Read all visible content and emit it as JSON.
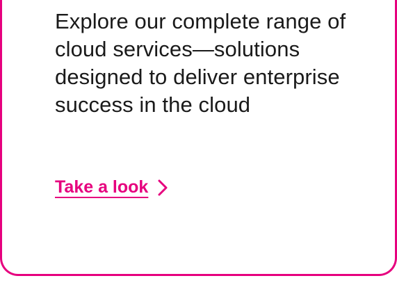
{
  "card": {
    "description": "Explore our complete range of cloud services—solutions designed to deliver enterprise success in the cloud",
    "cta_label": "Take a look",
    "cta_icon": "chevron-right-icon",
    "accent_color": "#e6007e"
  }
}
